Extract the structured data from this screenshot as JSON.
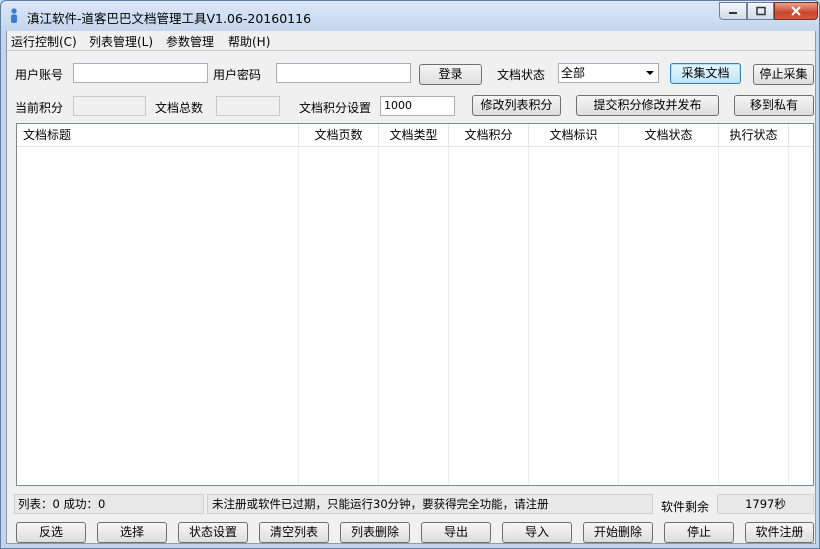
{
  "window": {
    "title": "滇江软件-道客巴巴文档管理工具V1.06-20160116",
    "icon": "person-icon",
    "caption_buttons": [
      "minimize-icon",
      "maximize-icon",
      "close-icon"
    ]
  },
  "menu": [
    "运行控制(C)",
    "列表管理(L)",
    "参数管理",
    "帮助(H)"
  ],
  "form": {
    "username_label": "用户账号",
    "username_value": "",
    "password_label": "用户密码",
    "password_value": "",
    "login_button": "登录",
    "doc_status_label": "文档状态",
    "doc_status_value": "全部",
    "collect_button": "采集文档",
    "stop_collect_button": "停止采集",
    "points_label": "当前积分",
    "points_value": "",
    "total_docs_label": "文档总数",
    "total_docs_value": "",
    "points_setting_label": "文档积分设置",
    "points_setting_value": "1000",
    "modify_points_button": "修改列表积分",
    "submit_publish_button": "提交积分修改并发布",
    "move_private_button": "移到私有"
  },
  "table": {
    "columns": [
      "文档标题",
      "文档页数",
      "文档类型",
      "文档积分",
      "文档标识",
      "文档状态",
      "执行状态"
    ],
    "rows": []
  },
  "status": {
    "list_summary": "列表：0 成功：0",
    "message": "未注册或软件已过期，只能运行30分钟，要获得完全功能，请注册",
    "remaining_label": "软件剩余",
    "remaining_value": "1797秒"
  },
  "bottom_buttons": [
    "反选",
    "选择",
    "状态设置",
    "清空列表",
    "列表删除",
    "导出",
    "导入",
    "开始删除",
    "停止",
    "软件注册"
  ]
}
